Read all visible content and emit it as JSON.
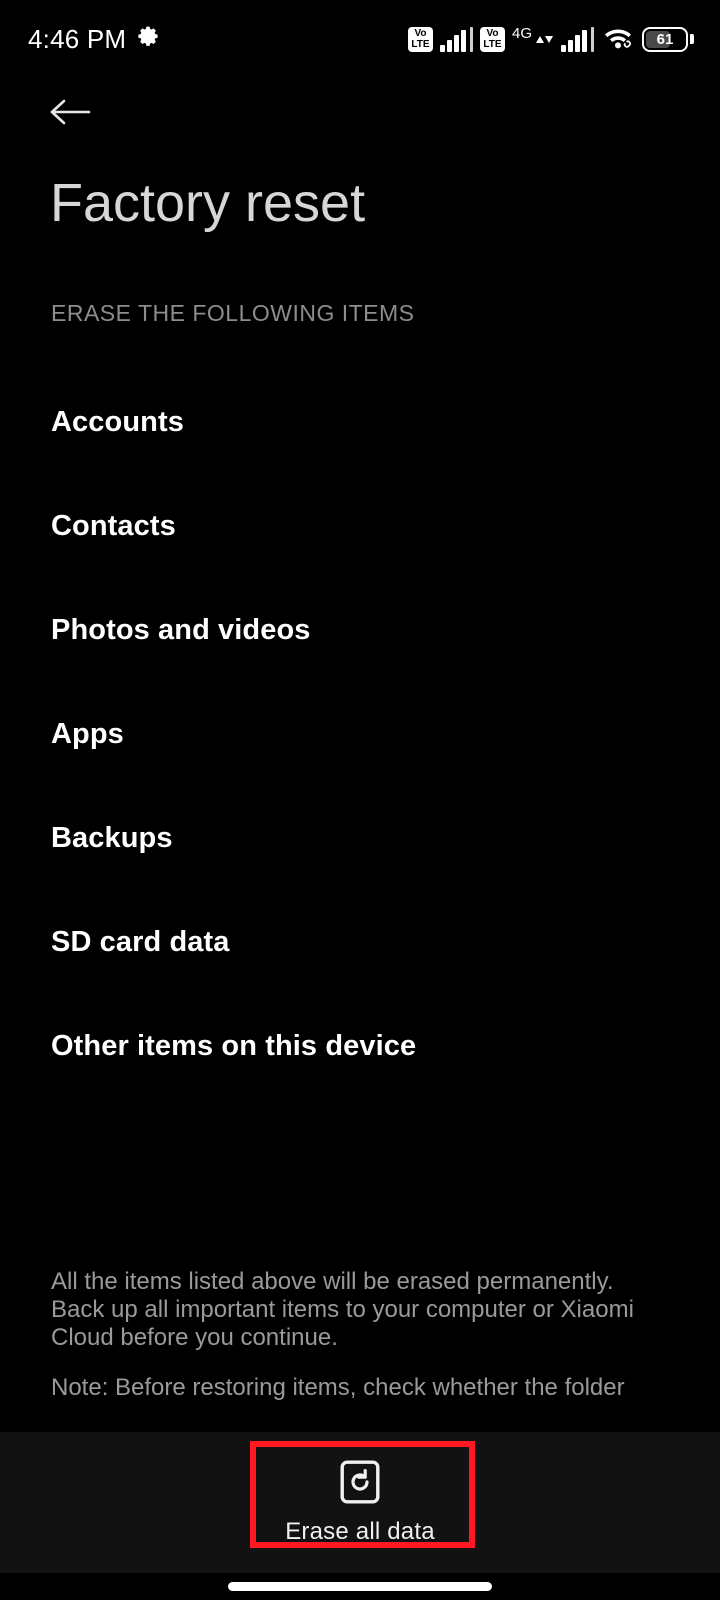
{
  "status_bar": {
    "clock": "4:46 PM",
    "settings_icon": "gear-icon",
    "sim1_volte_top": "Vo",
    "sim1_volte_bottom": "LTE",
    "sim2_volte_top": "Vo",
    "sim2_volte_bottom": "LTE",
    "network_type": "4G",
    "wifi_icon": "wifi-icon",
    "wifi_link_icon": "link-icon",
    "battery_level": "61"
  },
  "header": {
    "back_icon": "back-arrow-icon",
    "title": "Factory reset"
  },
  "section": {
    "header": "ERASE THE FOLLOWING ITEMS",
    "items": [
      {
        "label": "Accounts"
      },
      {
        "label": "Contacts"
      },
      {
        "label": "Photos and videos"
      },
      {
        "label": "Apps"
      },
      {
        "label": "Backups"
      },
      {
        "label": "SD card data"
      },
      {
        "label": "Other items on this device"
      }
    ]
  },
  "footer": {
    "warning": "All the items listed above will be erased permanently. Back up all important items to your computer or Xiaomi Cloud before you continue.",
    "note": "Note: Before restoring items, check whether the folder"
  },
  "bottom_bar": {
    "erase_icon": "reset-icon",
    "erase_label": "Erase all data"
  },
  "annotation": {
    "highlight_color": "#ff1721"
  },
  "nav": {
    "home_indicator": "home-indicator"
  }
}
